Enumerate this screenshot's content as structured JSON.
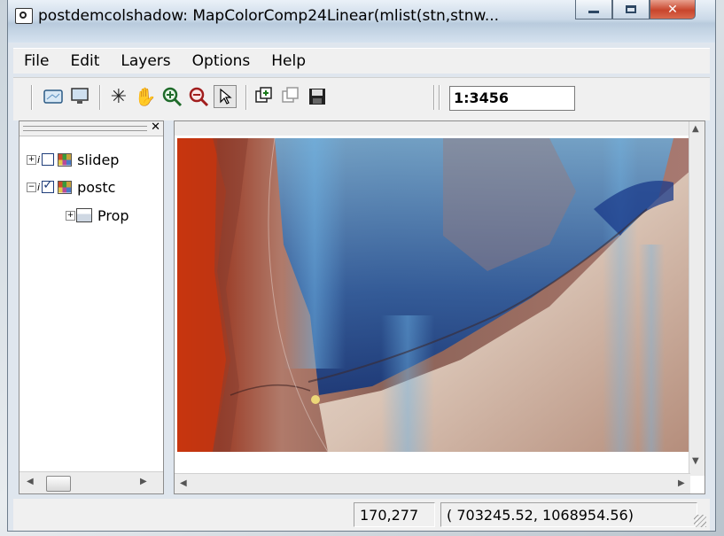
{
  "window": {
    "title": "postdemcolshadow: MapColorComp24Linear(mlist(stn,stnw..."
  },
  "menu": [
    "File",
    "Edit",
    "Layers",
    "Options",
    "Help"
  ],
  "toolbar": {
    "tools": [
      {
        "icon": "open-map-icon"
      },
      {
        "icon": "display-monitor-icon"
      },
      {
        "icon": "compass-star-icon"
      },
      {
        "icon": "pan-hand-icon"
      },
      {
        "icon": "zoom-in-icon"
      },
      {
        "icon": "zoom-out-icon"
      },
      {
        "icon": "select-arrow-icon",
        "pressed": true
      },
      {
        "icon": "add-layer-icon"
      },
      {
        "icon": "copy-layer-icon"
      },
      {
        "icon": "save-icon"
      }
    ],
    "scale": "1:3456"
  },
  "layers": [
    {
      "label": "slidep",
      "checked": false
    },
    {
      "label": "postc",
      "checked": true
    }
  ],
  "properties_label": "Prop",
  "status": {
    "pixel": "170,277",
    "coords": "(  703245.52,  1068954.56)"
  }
}
